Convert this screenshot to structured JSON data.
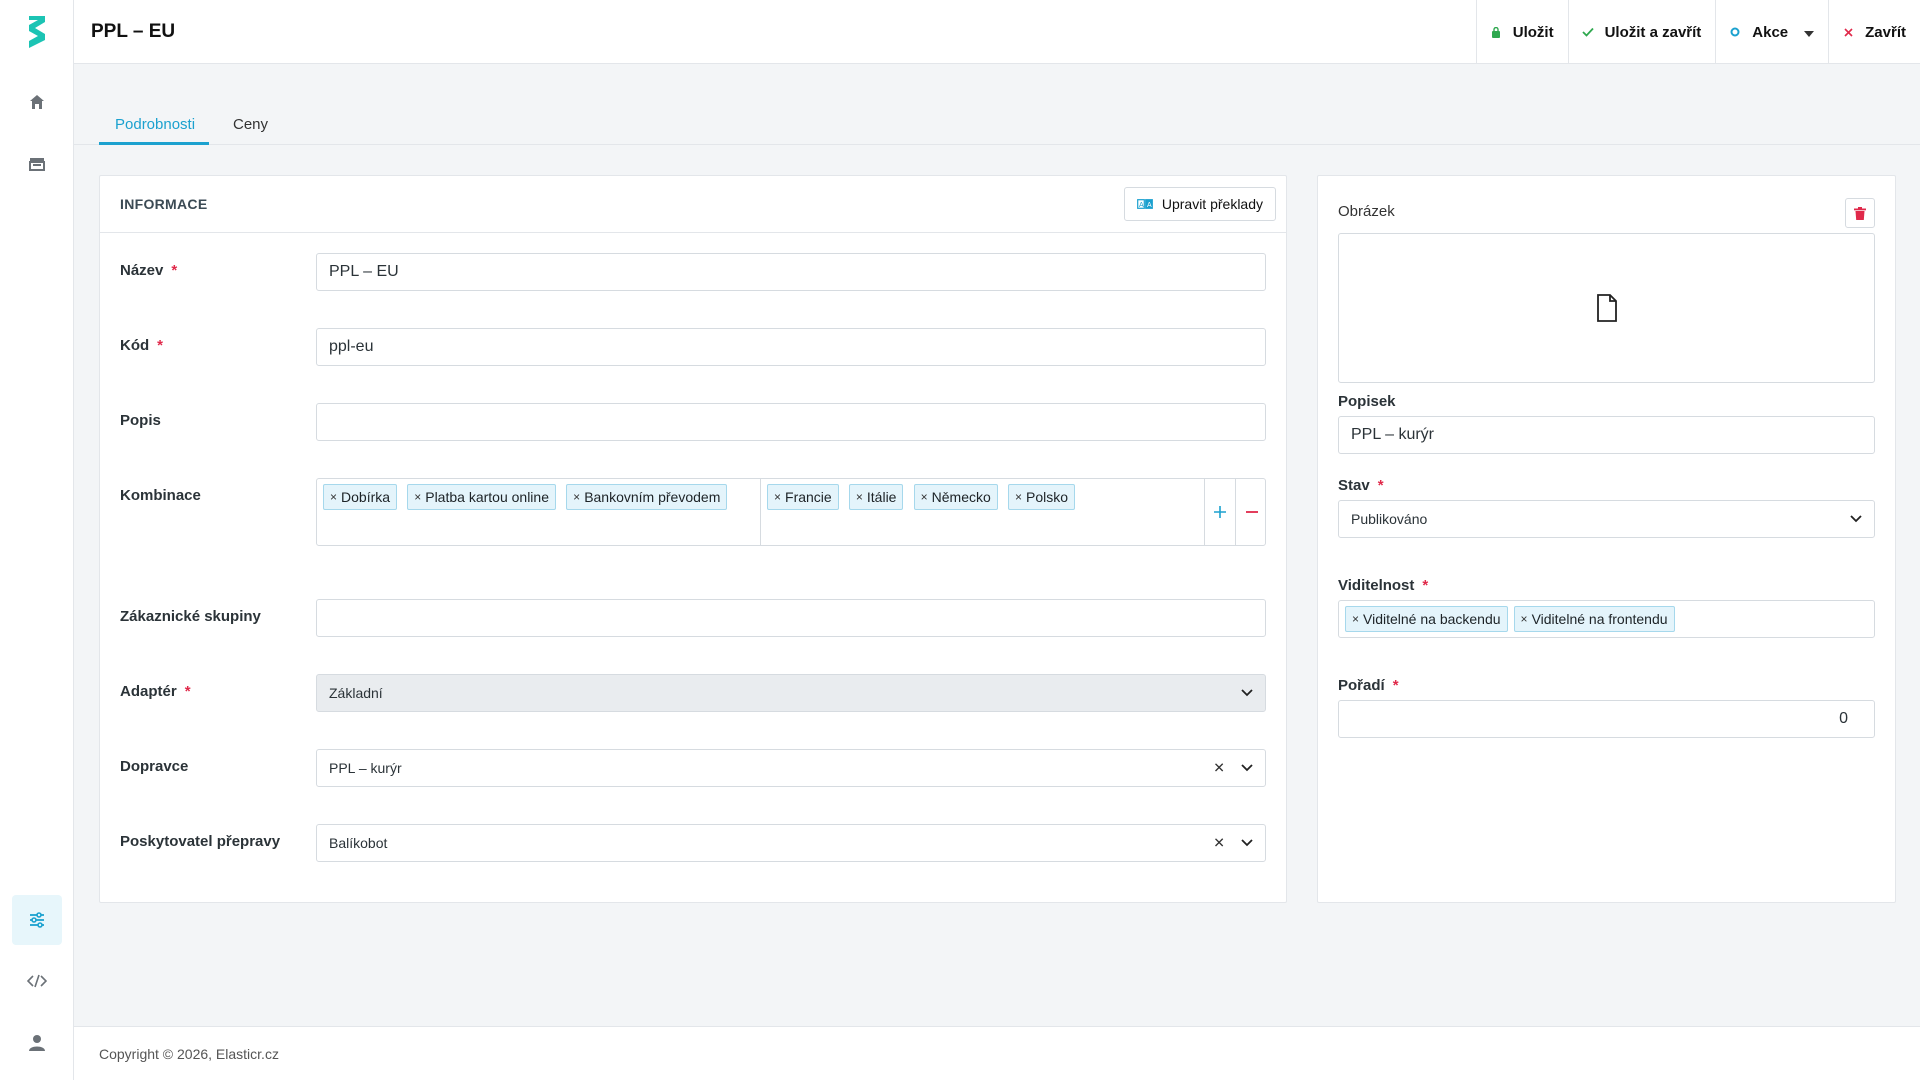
{
  "app": {
    "title": "PPL – EU"
  },
  "toolbar": {
    "save": "Uložit",
    "save_close": "Uložit a zavřít",
    "actions": "Akce",
    "close": "Zavřít"
  },
  "tabs": [
    {
      "label": "Podrobnosti",
      "active": true
    },
    {
      "label": "Ceny",
      "active": false
    }
  ],
  "info": {
    "title": "INFORMACE",
    "translate_button": "Upravit překlady",
    "fields": {
      "name": {
        "label": "Název",
        "value": "PPL – EU"
      },
      "code": {
        "label": "Kód",
        "value": "ppl-eu"
      },
      "description": {
        "label": "Popis",
        "value": ""
      },
      "combinations": {
        "label": "Kombinace",
        "payments": [
          "Dobírka",
          "Platba kartou online",
          "Bankovním převodem"
        ],
        "countries": [
          "Francie",
          "Itálie",
          "Německo",
          "Polsko"
        ]
      },
      "customer_groups": {
        "label": "Zákaznické skupiny",
        "value": ""
      },
      "adapter": {
        "label": "Adaptér",
        "value": "Základní"
      },
      "carrier": {
        "label": "Dopravce",
        "value": "PPL – kurýr"
      },
      "shipping_provider": {
        "label": "Poskytovatel přepravy",
        "value": "Balíkobot"
      }
    }
  },
  "side": {
    "image_label": "Obrázek",
    "caption": {
      "label": "Popisek",
      "value": "PPL – kurýr"
    },
    "status": {
      "label": "Stav",
      "value": "Publikováno"
    },
    "visibility": {
      "label": "Viditelnost",
      "tags": [
        "Viditelné na backendu",
        "Viditelné na frontendu"
      ]
    },
    "order": {
      "label": "Pořadí",
      "value": "0"
    }
  },
  "footer": {
    "text": "Copyright © 2026, Elasticr.cz"
  },
  "colors": {
    "accent": "#1ba1cf",
    "required": "#e0294a",
    "save_icon": "#2fa84f"
  }
}
